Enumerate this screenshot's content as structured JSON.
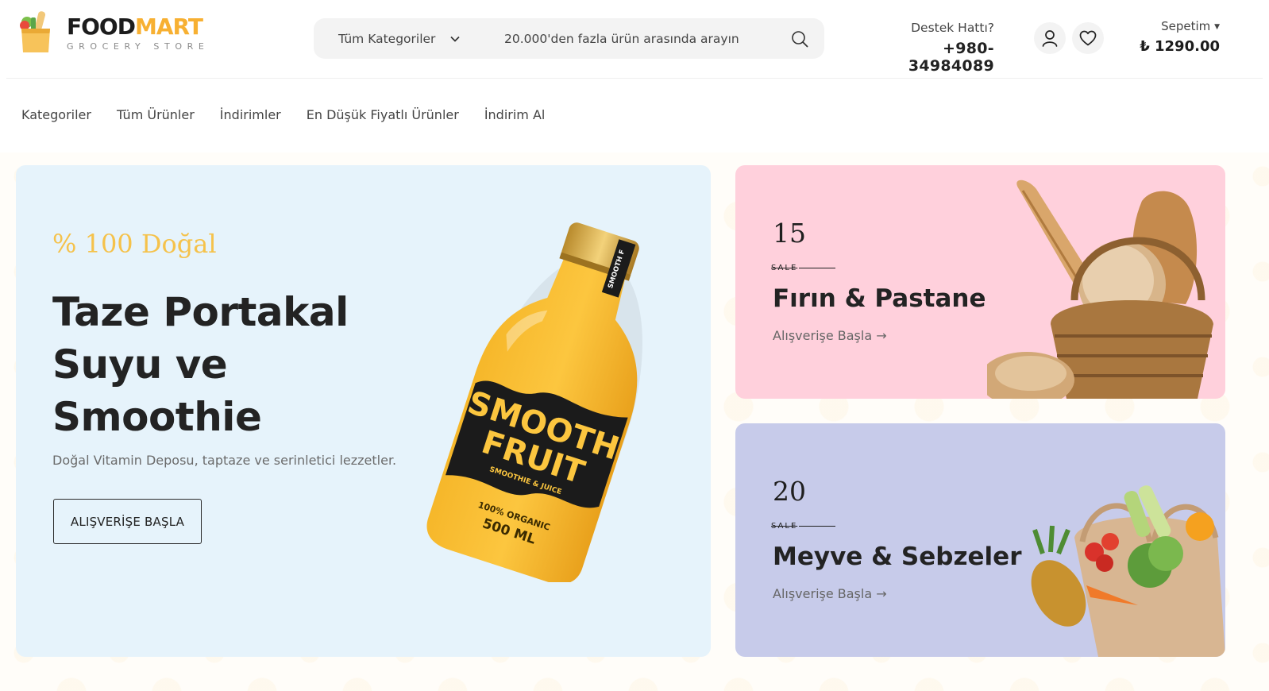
{
  "brand": {
    "name_part1": "FOOD",
    "name_part2": "MART",
    "tagline": "GROCERY STORE",
    "colors": {
      "accent": "#f7b032",
      "dark": "#1c1c1c"
    }
  },
  "search": {
    "category": "Tüm Kategoriler",
    "placeholder": "20.000'den fazla ürün arasında arayın"
  },
  "support": {
    "label": "Destek Hattı?",
    "phone": "+980-34984089"
  },
  "header_icons": [
    "user-icon",
    "heart-icon"
  ],
  "cart": {
    "label": "Sepetim",
    "total": "₺ 1290.00"
  },
  "nav": {
    "items": [
      "Kategoriler",
      "Tüm Ürünler",
      "İndirimler",
      "En Düşük Fiyatlı Ürünler",
      "İndirim Al"
    ]
  },
  "hero": {
    "tag": "% 100 Doğal",
    "title": "Taze Portakal Suyu ve Smoothie",
    "description": "Doğal Vitamin Deposu, taptaze ve serinletici lezzetler.",
    "button": "ALIŞVERİŞE BAŞLA",
    "bottle": {
      "cap_label": "SMOOTH F",
      "logo_line1": "SMOOTH",
      "logo_line2": "FRUIT",
      "logo_sub": "SMOOTHIE & JUICE",
      "organic": "100% ORGANIC",
      "volume": "500 ML"
    },
    "bg_color": "#e6f3fb"
  },
  "promos": [
    {
      "number": "15",
      "sale": "SALE",
      "title": "Fırın & Pastane",
      "link": "Alışverişe Başla",
      "bg_color": "#ffd0dc"
    },
    {
      "number": "20",
      "sale": "SALE",
      "title": "Meyve & Sebzeler",
      "link": "Alışverişe Başla",
      "bg_color": "#c7cbea"
    }
  ]
}
